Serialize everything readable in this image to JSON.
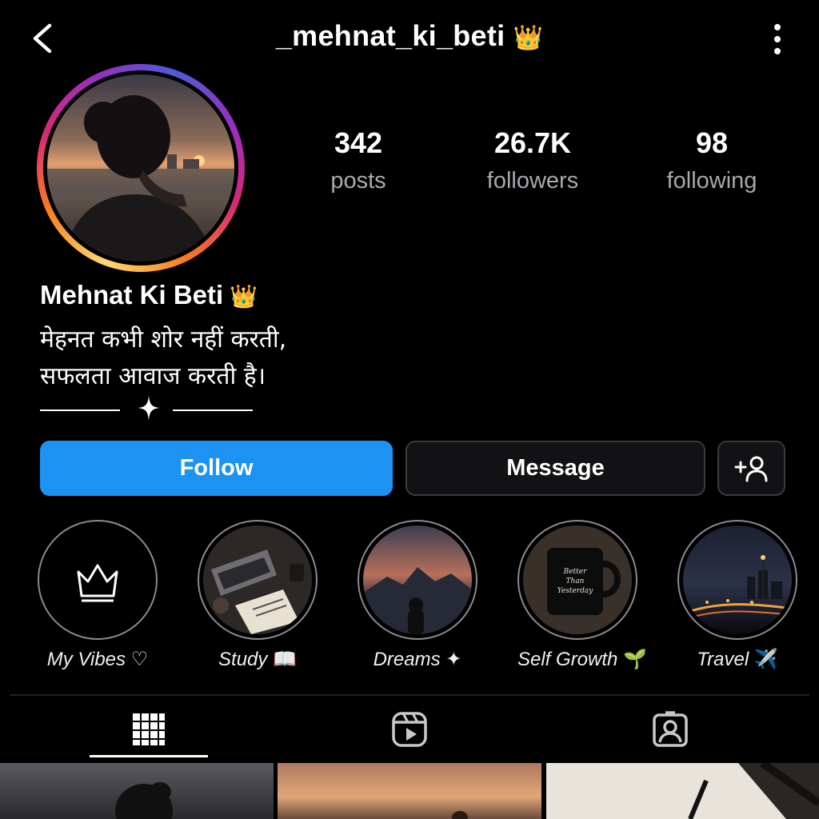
{
  "header": {
    "username": "_mehnat_ki_beti",
    "username_badge": "👑"
  },
  "stats": {
    "posts_value": "342",
    "posts_label": "posts",
    "followers_value": "26.7K",
    "followers_label": "followers",
    "following_value": "98",
    "following_label": "following"
  },
  "bio": {
    "display_name": "Mehnat Ki Beti",
    "display_name_badge": "👑",
    "line1": "मेहनत कभी शोर नहीं करती,",
    "line2": "सफलता आवाज करती है।"
  },
  "actions": {
    "follow_label": "Follow",
    "message_label": "Message",
    "add_user_icon": "add-person-icon"
  },
  "highlights": [
    {
      "label": "My Vibes",
      "emoji": "♡",
      "icon": "crown-icon"
    },
    {
      "label": "Study",
      "emoji": "📖"
    },
    {
      "label": "Dreams",
      "emoji": "✦"
    },
    {
      "label": "Self Growth",
      "emoji": "🌱",
      "mug_text": "Better Than Yesterday"
    },
    {
      "label": "Travel",
      "emoji": "✈️"
    }
  ],
  "tabs": [
    {
      "icon": "grid-icon",
      "active": true
    },
    {
      "icon": "reels-icon",
      "active": false
    },
    {
      "icon": "tagged-icon",
      "active": false
    }
  ],
  "colors": {
    "background": "#000000",
    "follow_button": "#1c92f2",
    "secondary_button": "#121214",
    "muted_text": "#a8a8ae",
    "crown": "#f2c14e"
  }
}
